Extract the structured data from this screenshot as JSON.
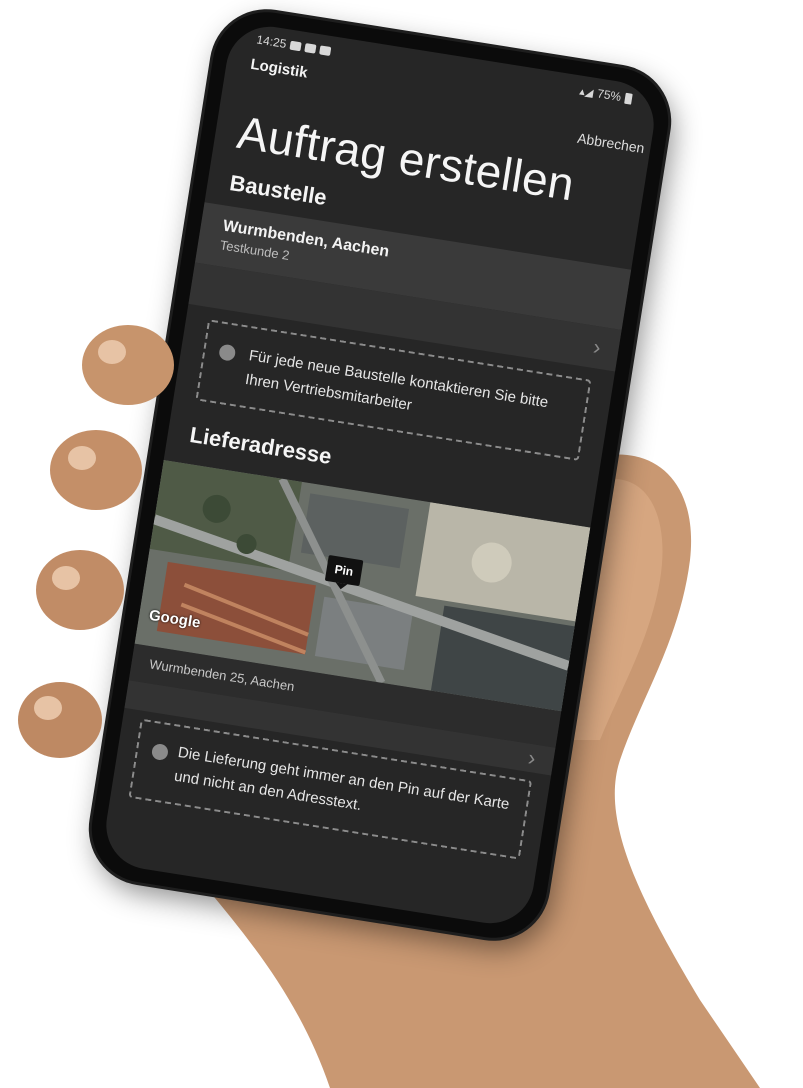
{
  "status_bar": {
    "time": "14:25",
    "battery": "75%"
  },
  "appbar": {
    "title": "Logistik",
    "cancel_label": "Abbrechen"
  },
  "page": {
    "title": "Auftrag erstellen"
  },
  "construction_site": {
    "section_title": "Baustelle",
    "name": "Wurmbenden, Aachen",
    "customer": "Testkunde 2",
    "info_text": "Für jede neue Baustelle kontaktieren Sie bitte Ihren Vertriebsmitarbeiter"
  },
  "delivery_address": {
    "section_title": "Lieferadresse",
    "map_pin_label": "Pin",
    "map_attribution": "Google",
    "address": "Wurmbenden 25, Aachen",
    "info_text": "Die Lieferung geht immer an den Pin auf der Karte und nicht an den Adresstext."
  },
  "icons": {
    "chevron": "chevron-right-icon",
    "info": "info-icon"
  }
}
